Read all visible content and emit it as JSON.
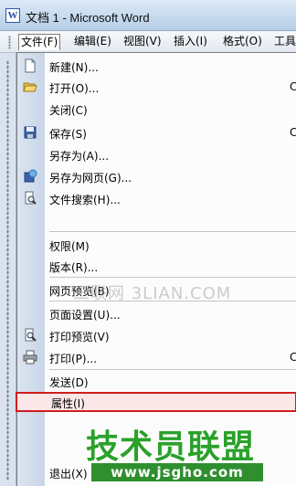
{
  "window": {
    "title": "文档 1 - Microsoft Word",
    "app_icon": "word-doc-icon"
  },
  "menubar": {
    "items": [
      {
        "label": "文件(F)",
        "active": true
      },
      {
        "label": "编辑(E)"
      },
      {
        "label": "视图(V)"
      },
      {
        "label": "插入(I)"
      },
      {
        "label": "格式(O)"
      },
      {
        "label": "工具"
      }
    ]
  },
  "file_menu": {
    "items": [
      {
        "label": "新建(N)...",
        "icon": "new-document-icon"
      },
      {
        "label": "打开(O)...",
        "icon": "open-folder-icon",
        "shortcut": "C"
      },
      {
        "label": "关闭(C)"
      },
      {
        "label": "保存(S)",
        "icon": "save-disk-icon",
        "shortcut": "C"
      },
      {
        "label": "另存为(A)..."
      },
      {
        "label": "另存为网页(G)...",
        "icon": "save-as-web-icon"
      },
      {
        "label": "文件搜索(H)...",
        "icon": "file-search-icon"
      },
      {
        "label": "权限(M)"
      },
      {
        "label": "版本(R)..."
      },
      {
        "label": "网页预览(B)"
      },
      {
        "label": "页面设置(U)..."
      },
      {
        "label": "打印预览(V)",
        "icon": "print-preview-icon"
      },
      {
        "label": "打印(P)...",
        "icon": "printer-icon",
        "shortcut": "C"
      },
      {
        "label": "发送(D)"
      },
      {
        "label": "属性(I)",
        "highlighted": true
      },
      {
        "label": "退出(X)"
      }
    ]
  },
  "watermarks": {
    "site_3lian": "三联网 3LIAN.COM",
    "title_cn": "技术员联盟",
    "url": "www.jsgho.com"
  },
  "colors": {
    "highlight_border": "#d11d1d",
    "watermark_green": "#2aa12a"
  }
}
